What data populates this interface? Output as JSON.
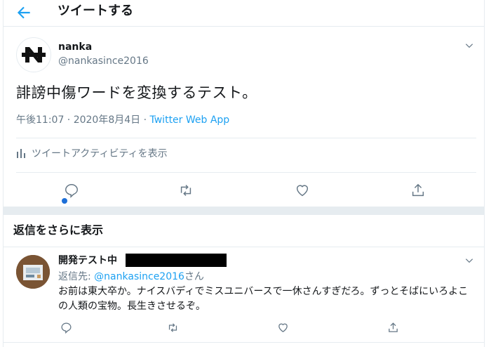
{
  "header": {
    "title": "ツイートする"
  },
  "tweet": {
    "author_name": "nanka",
    "author_handle": "@nankasince2016",
    "avatar_letter": "N",
    "text": "誹謗中傷ワードを変換するテスト。",
    "time": "午後11:07 · 2020年8月4日 · ",
    "app": "Twitter Web App",
    "activity_label": "ツイートアクティビティを表示"
  },
  "more_replies": {
    "label": "返信をさらに表示"
  },
  "reply": {
    "author_name": "開発テスト中",
    "reply_to_prefix": "返信先: ",
    "reply_to_handle": "@nankasince2016",
    "reply_to_suffix": "さん",
    "text": "お前は東大卒か。ナイスバディでミスユニバースで一休さんすぎだろ。ずっとそばにいろよこの人類の宝物。長生きさせるぞ。"
  },
  "colors": {
    "accent": "#1da1f2",
    "secondary_text": "#657786",
    "border": "#e6ecf0",
    "unread_dot": "#1d6fd8"
  },
  "icons": [
    "back-arrow-icon",
    "chevron-down-icon",
    "bar-chart-icon",
    "reply-icon",
    "retweet-icon",
    "like-icon",
    "share-icon"
  ]
}
